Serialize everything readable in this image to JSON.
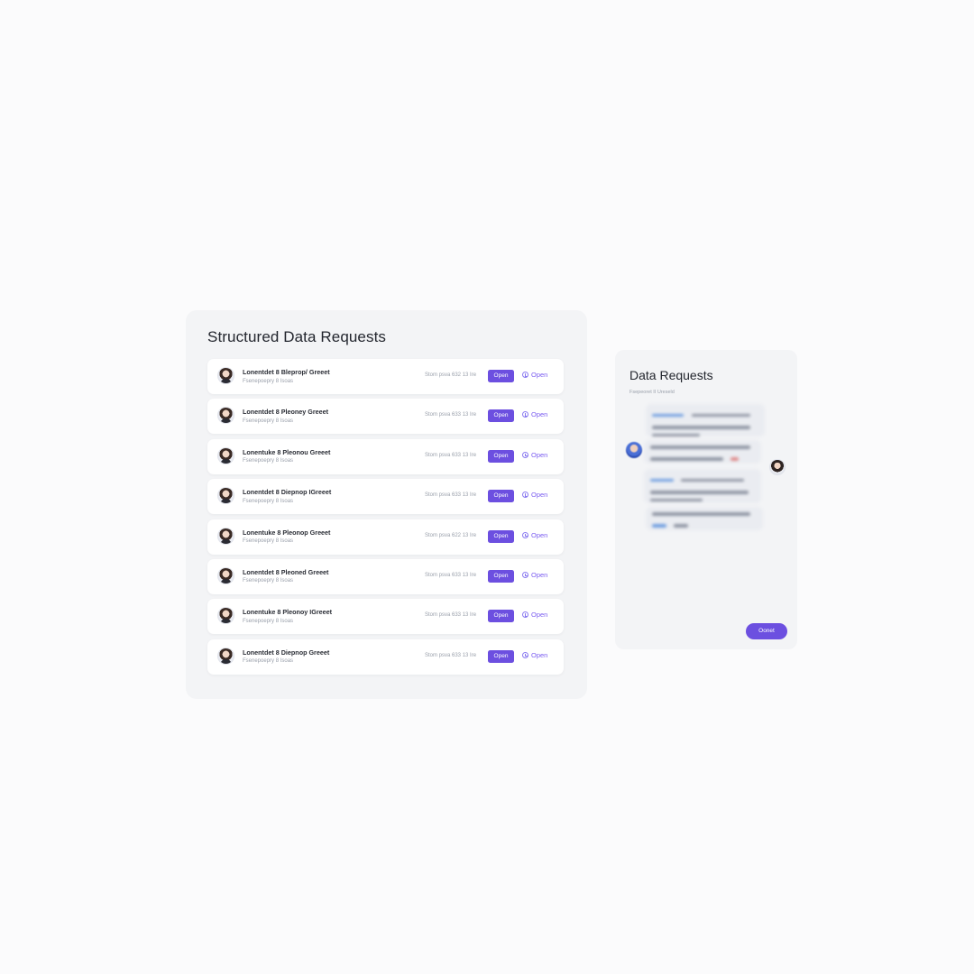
{
  "main": {
    "title": "Structured Data Requests",
    "rows": [
      {
        "title": "Lonentdet 8 Bleprop/ Greeet",
        "sub": "Fsenepoepry 8 Isoas",
        "meta": "Stom psva 632 13 Ire",
        "button": "Open",
        "link": "Open"
      },
      {
        "title": "Lonentdet 8 Pleoney Greeet",
        "sub": "Fsenepoepry 8 Isoas",
        "meta": "Stom psva 633 13 Ire",
        "button": "Open",
        "link": "Open"
      },
      {
        "title": "Lonentuke 8 Pleonou Greeet",
        "sub": "Fsenepoepry 8 Isoas",
        "meta": "Stom psva 633 13 Ire",
        "button": "Open",
        "link": "Open"
      },
      {
        "title": "Lonentdet 8 Diepnop IGreeet",
        "sub": "Fsenepoepry 8 Isoas",
        "meta": "Stom psva 633 13 Ire",
        "button": "Open",
        "link": "Open"
      },
      {
        "title": "Lonentuke 8 Pleonop Greeet",
        "sub": "Fsenepoepry 8 Isoas",
        "meta": "Stom psva 622 13 Ire",
        "button": "Open",
        "link": "Open"
      },
      {
        "title": "Lonentdet 8 Pleoned Greeet",
        "sub": "Fsenepoepry 8 Isoas",
        "meta": "Stom psva 633 13 Ire",
        "button": "Open",
        "link": "Open"
      },
      {
        "title": "Lonentuke 8 Pleonoy IGreeet",
        "sub": "Fsenepoepry 8 Isoas",
        "meta": "Stom psva 633 13 Ire",
        "button": "Open",
        "link": "Open"
      },
      {
        "title": "Lonentdet 8 Diepnop Greeet",
        "sub": "Fsenepoepry 8 Isoas",
        "meta": "Stom psva 633 13 Ire",
        "button": "Open",
        "link": "Open"
      }
    ]
  },
  "side": {
    "title": "Data Requests",
    "subtitle": "Fsepeoret II Ureseld",
    "close_label": "Oonet"
  },
  "colors": {
    "accent": "#6c4fe0",
    "link": "#7a5cf0",
    "panel": "#f3f4f6"
  },
  "icons": {
    "row_avatar": "user-avatar-icon",
    "open_link": "clock-icon"
  }
}
